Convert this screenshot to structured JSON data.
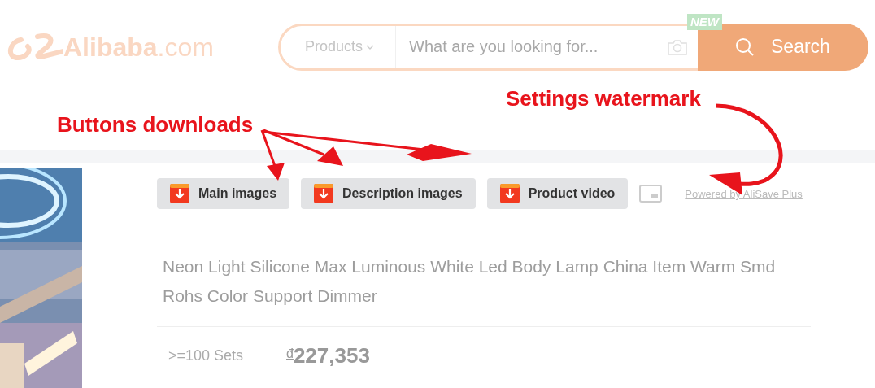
{
  "header": {
    "logo": {
      "name": "Alibaba",
      "suffix": ".com"
    },
    "search": {
      "category": "Products",
      "placeholder": "What are you looking for...",
      "badge": "NEW",
      "button": "Search"
    }
  },
  "annotations": [
    {
      "text": "Settings watermark"
    },
    {
      "text": "Buttons downloads"
    }
  ],
  "downloader": {
    "buttons": [
      "Main images",
      "Description images",
      "Product video"
    ],
    "credit": "Powered by AliSave Plus"
  },
  "product": {
    "title": "Neon Light Silicone Max Luminous White Led Body Lamp China Item Warm Smd Rohs Color Support Dimmer",
    "price_tiers": [
      {
        "quantity": ">=100 Sets",
        "currency": "đ",
        "price": "227,353"
      }
    ]
  }
}
